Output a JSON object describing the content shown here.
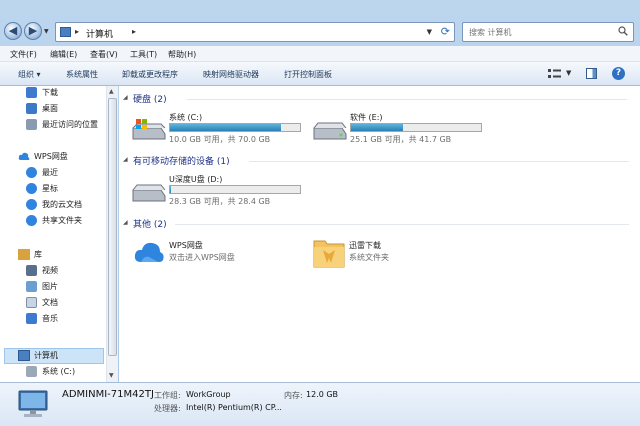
{
  "address_bar": {
    "breadcrumb": "计算机",
    "search_placeholder": "搜索 计算机"
  },
  "menu": [
    "文件(F)",
    "编辑(E)",
    "查看(V)",
    "工具(T)",
    "帮助(H)"
  ],
  "toolbar": {
    "organize": "组织",
    "system_properties": "系统属性",
    "uninstall": "卸载或更改程序",
    "map_drive": "映射网络驱动器",
    "control_panel": "打开控制面板"
  },
  "sidebar": {
    "favorites": [
      "下载",
      "桌面",
      "最近访问的位置"
    ],
    "wps_drive": "WPS网盘",
    "wps_items": [
      "最近",
      "星标",
      "我的云文档",
      "共享文件夹"
    ],
    "library": "库",
    "library_items": [
      "视频",
      "图片",
      "文档",
      "音乐"
    ],
    "computer": "计算机",
    "computer_items": [
      "系统 (C:)"
    ]
  },
  "groups": {
    "hard_disks": "硬盘 (2)",
    "removable": "有可移动存储的设备 (1)",
    "other": "其他 (2)"
  },
  "drives": [
    {
      "name": "系统 (C:)",
      "free": "10.0 GB 可用，共 70.0 GB",
      "used_fraction": 0.857
    },
    {
      "name": "软件 (E:)",
      "free": "25.1 GB 可用，共 41.7 GB",
      "used_fraction": 0.398
    },
    {
      "name": "U深度U盘 (D:)",
      "free": "28.3 GB 可用，共 28.4 GB",
      "used_fraction": 0.004
    }
  ],
  "others": [
    {
      "name": "WPS网盘",
      "desc": "双击进入WPS网盘"
    },
    {
      "name": "迅雷下载",
      "desc": "系统文件夹"
    }
  ],
  "details": {
    "pc_name": "ADMINMI-71M42TJ",
    "workgroup_label": "工作组:",
    "workgroup": "WorkGroup",
    "memory_label": "内存:",
    "memory": "12.0 GB",
    "cpu_label": "处理器:",
    "cpu": "Intel(R) Pentium(R) CP..."
  }
}
